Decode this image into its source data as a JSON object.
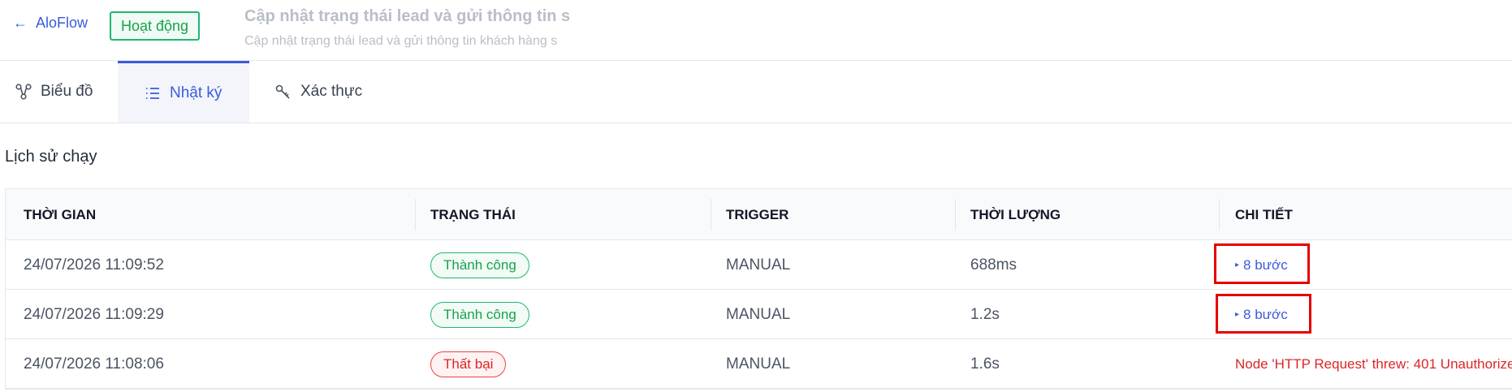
{
  "header": {
    "back_label": "AloFlow",
    "status": "Hoạt động",
    "flow_name": "Cập nhật trạng thái lead và gửi thông tin s",
    "flow_description": "Cập nhật trạng thái lead và gửi thông tin khách hàng s"
  },
  "tabs": [
    {
      "label": "Biểu đồ",
      "icon": "diagram-icon"
    },
    {
      "label": "Nhật ký",
      "icon": "list-icon",
      "active": true
    },
    {
      "label": "Xác thực",
      "icon": "key-icon"
    }
  ],
  "section": {
    "title": "Lịch sử chạy"
  },
  "table": {
    "columns": [
      "THỜI GIAN",
      "TRẠNG THÁI",
      "TRIGGER",
      "THỜI LƯỢNG",
      "CHI TIẾT"
    ],
    "rows": [
      {
        "time": "24/07/2026 11:09:52",
        "status": "Thành công",
        "status_type": "success",
        "trigger": "MANUAL",
        "duration": "688ms",
        "detail": "8 bước",
        "detail_type": "link"
      },
      {
        "time": "24/07/2026 11:09:29",
        "status": "Thành công",
        "status_type": "success",
        "trigger": "MANUAL",
        "duration": "1.2s",
        "detail": "8 bước",
        "detail_type": "link"
      },
      {
        "time": "24/07/2026 11:08:06",
        "status": "Thất bại",
        "status_type": "fail",
        "trigger": "MANUAL",
        "duration": "1.6s",
        "detail": "Node 'HTTP Request' threw: 401 Unauthorize",
        "detail_type": "error"
      }
    ]
  },
  "colors": {
    "accent": "#3b5bdb",
    "success": "#16a34a",
    "error": "#dc2626",
    "highlight": "#e60000"
  }
}
